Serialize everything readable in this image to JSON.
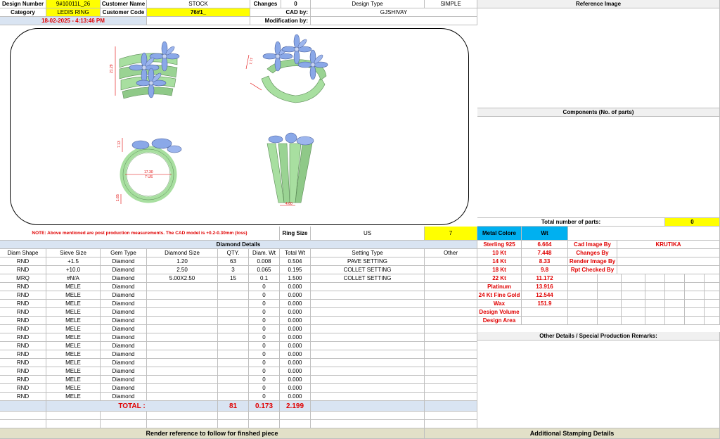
{
  "header": {
    "design_number_label": "Design Number",
    "design_number": "9#10011L_26",
    "customer_name_label": "Customer Name",
    "customer_name": "STOCK",
    "changes_label": "Changes",
    "changes": "0",
    "design_type_label": "Design Type",
    "design_type": "SIMPLE",
    "category_label": "Category",
    "category": "LEDIS RING",
    "customer_code_label": "Customer Code",
    "customer_code": "76#1_",
    "cad_by_label": "CAD by:",
    "cad_by": "GJSHIVAY",
    "modification_by_label": "Modification by:",
    "timestamp": "18-02-2025 - 4:13:46 PM"
  },
  "render": {
    "dim_height": "21.29",
    "dim_side": "7.77",
    "dim_top": "7.13",
    "dim_inner": "17.30",
    "dim_us": "7 US",
    "dim_base": "1.65",
    "dim_shank": "4.60"
  },
  "reference": {
    "title": "Reference Image",
    "components_title": "Components (No. of parts)",
    "total_parts_label": "Total number of parts:",
    "total_parts": "0"
  },
  "note": {
    "text": "NOTE: Above mentioned are post production measurements. The CAD model is +0.2-0.30mm (loss)",
    "ring_size_label": "Ring Size",
    "ring_size_system": "US",
    "ring_size": "7"
  },
  "metal": {
    "metal_color_label": "Metal Colore",
    "wt_label": "Wt",
    "rows": [
      {
        "name": "Sterling 925",
        "wt": "6.664"
      },
      {
        "name": "10 Kt",
        "wt": "7.448"
      },
      {
        "name": "14 Kt",
        "wt": "8.33"
      },
      {
        "name": "18 Kt",
        "wt": "9.8"
      },
      {
        "name": "22 Kt",
        "wt": "11.172"
      },
      {
        "name": "Platinum",
        "wt": "13.916"
      },
      {
        "name": "24 Kt Fine Gold",
        "wt": "12.544"
      },
      {
        "name": "Wax",
        "wt": "151.9"
      },
      {
        "name": "Design Volume",
        "wt": ""
      },
      {
        "name": "Design Area",
        "wt": ""
      }
    ],
    "cad_image_by_label": "Cad Image By",
    "cad_image_by": "KRUTIKA",
    "changes_by_label": "Changes By",
    "render_image_by_label": "Render Image By",
    "rpt_checked_by_label": "Rpt Checked By",
    "other_details_title": "Other Details / Special Production Remarks:"
  },
  "diamond": {
    "title": "Diamond Details",
    "columns": [
      "Diam Shape",
      "Sieve Size",
      "Gem Type",
      "Diamond Size",
      "QTY.",
      "Diam. Wt",
      "Total Wt",
      "Setting Type",
      "Other"
    ],
    "rows": [
      [
        "RND",
        "+1.5",
        "Diamond",
        "1.20",
        "63",
        "0.008",
        "0.504",
        "PAVE SETTING",
        ""
      ],
      [
        "RND",
        "+10.0",
        "Diamond",
        "2.50",
        "3",
        "0.065",
        "0.195",
        "COLLET SETTING",
        ""
      ],
      [
        "MRQ",
        "#N/A",
        "Diamond",
        "5.00X2.50",
        "15",
        "0.1",
        "1.500",
        "COLLET SETTING",
        ""
      ],
      [
        "RND",
        "MELE",
        "Diamond",
        "",
        "",
        "0",
        "0.000",
        "",
        ""
      ],
      [
        "RND",
        "MELE",
        "Diamond",
        "",
        "",
        "0",
        "0.000",
        "",
        ""
      ],
      [
        "RND",
        "MELE",
        "Diamond",
        "",
        "",
        "0",
        "0.000",
        "",
        ""
      ],
      [
        "RND",
        "MELE",
        "Diamond",
        "",
        "",
        "0",
        "0.000",
        "",
        ""
      ],
      [
        "RND",
        "MELE",
        "Diamond",
        "",
        "",
        "0",
        "0.000",
        "",
        ""
      ],
      [
        "RND",
        "MELE",
        "Diamond",
        "",
        "",
        "0",
        "0.000",
        "",
        ""
      ],
      [
        "RND",
        "MELE",
        "Diamond",
        "",
        "",
        "0",
        "0.000",
        "",
        ""
      ],
      [
        "RND",
        "MELE",
        "Diamond",
        "",
        "",
        "0",
        "0.000",
        "",
        ""
      ],
      [
        "RND",
        "MELE",
        "Diamond",
        "",
        "",
        "0",
        "0.000",
        "",
        ""
      ],
      [
        "RND",
        "MELE",
        "Diamond",
        "",
        "",
        "0",
        "0.000",
        "",
        ""
      ],
      [
        "RND",
        "MELE",
        "Diamond",
        "",
        "",
        "0",
        "0.000",
        "",
        ""
      ],
      [
        "RND",
        "MELE",
        "Diamond",
        "",
        "",
        "0",
        "0.000",
        "",
        ""
      ],
      [
        "RND",
        "MELE",
        "Diamond",
        "",
        "",
        "0",
        "0.000",
        "",
        ""
      ],
      [
        "RND",
        "MELE",
        "Diamond",
        "",
        "",
        "0",
        "0.000",
        "",
        ""
      ]
    ],
    "total_label": "TOTAL :",
    "total_qty": "81",
    "total_diam_wt": "0.173",
    "total_wt": "2.199"
  },
  "footer": {
    "render_reference": "Render reference to follow for finshed piece",
    "additional_stamping": "Additional Stamping Details"
  },
  "colors": {
    "accent_yellow": "#ffff00",
    "accent_blue": "#00b0f0",
    "ring_green": "#a8dfa0",
    "stone_blue": "#8aa8e8",
    "text_red": "#e00000"
  }
}
